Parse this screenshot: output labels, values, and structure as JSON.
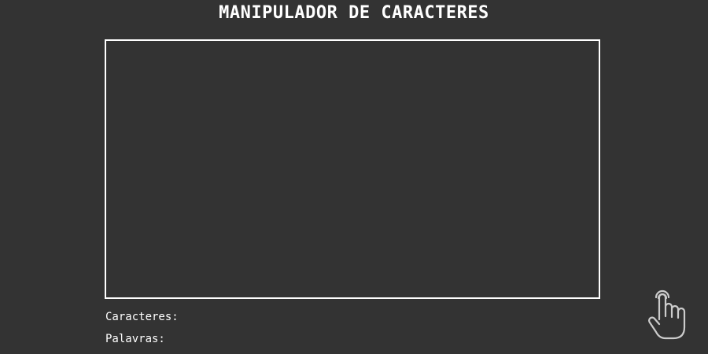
{
  "header": {
    "title": "MANIPULADOR DE CARACTERES"
  },
  "editor": {
    "value": "",
    "placeholder": ""
  },
  "stats": {
    "characters_label": "Caracteres:",
    "characters_value": "",
    "words_label": "Palavras:",
    "words_value": ""
  },
  "icons": {
    "pointer": "hand-pointer-icon"
  },
  "colors": {
    "background": "#333333",
    "foreground": "#ffffff",
    "icon": "#cccccc"
  }
}
